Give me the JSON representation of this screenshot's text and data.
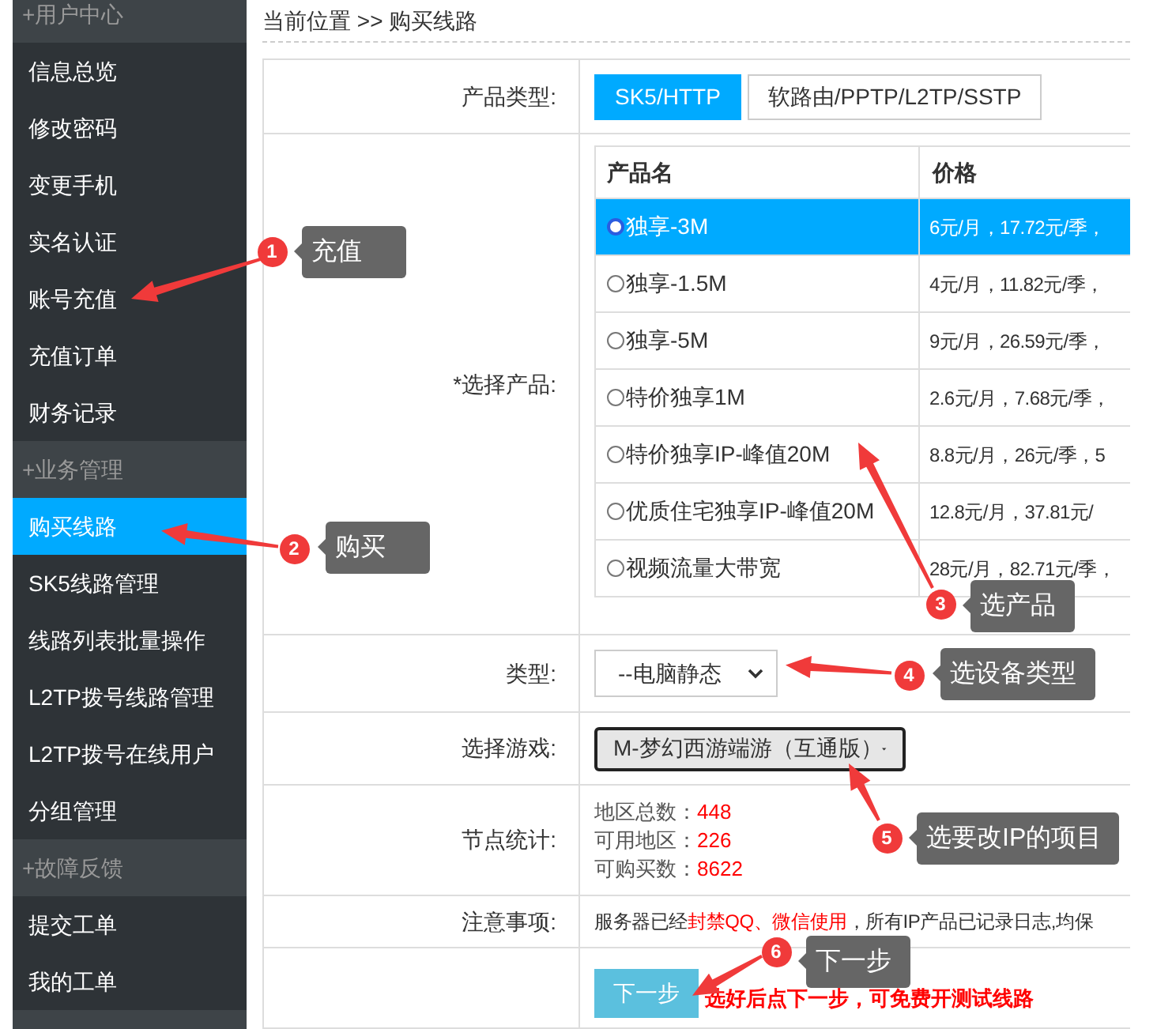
{
  "sidebar": {
    "groups": [
      {
        "title": "+用户中心",
        "items": [
          {
            "label": "信息总览",
            "selected": false
          },
          {
            "label": "修改密码",
            "selected": false
          },
          {
            "label": "变更手机",
            "selected": false
          },
          {
            "label": "实名认证",
            "selected": false
          },
          {
            "label": "账号充值",
            "selected": false
          },
          {
            "label": "充值订单",
            "selected": false
          },
          {
            "label": "财务记录",
            "selected": false
          }
        ]
      },
      {
        "title": "+业务管理",
        "items": [
          {
            "label": "购买线路",
            "selected": true
          },
          {
            "label": "SK5线路管理",
            "selected": false
          },
          {
            "label": "线路列表批量操作",
            "selected": false
          },
          {
            "label": "L2TP拨号线路管理",
            "selected": false
          },
          {
            "label": "L2TP拨号在线用户",
            "selected": false
          },
          {
            "label": "分组管理",
            "selected": false
          }
        ]
      },
      {
        "title": "+故障反馈",
        "items": [
          {
            "label": "提交工单",
            "selected": false
          },
          {
            "label": "我的工单",
            "selected": false
          }
        ]
      }
    ]
  },
  "breadcrumb": "当前位置 >> 购买线路",
  "form": {
    "product_type": {
      "label": "产品类型:",
      "tabs": [
        {
          "label": "SK5/HTTP",
          "selected": true
        },
        {
          "label": "软路由/PPTP/L2TP/SSTP",
          "selected": false
        }
      ]
    },
    "product": {
      "label": "*选择产品:",
      "columns": [
        "产品名",
        "价格"
      ],
      "rows": [
        {
          "name": "独享-3M",
          "price": "6元/月，17.72元/季，",
          "selected": true
        },
        {
          "name": "独享-1.5M",
          "price": "4元/月，11.82元/季，",
          "selected": false
        },
        {
          "name": "独享-5M",
          "price": "9元/月，26.59元/季，",
          "selected": false
        },
        {
          "name": "特价独享1M",
          "price": "2.6元/月，7.68元/季，",
          "selected": false
        },
        {
          "name": "特价独享IP-峰值20M",
          "price": "8.8元/月，26元/季，5",
          "selected": false
        },
        {
          "name": "优质住宅独享IP-峰值20M",
          "price": "12.8元/月，37.81元/",
          "selected": false
        },
        {
          "name": "视频流量大带宽",
          "price": "28元/月，82.71元/季，",
          "selected": false
        }
      ]
    },
    "type": {
      "label": "类型:",
      "value": "--电脑静态"
    },
    "game": {
      "label": "选择游戏:",
      "value": "M-梦幻西游端游（互通版）"
    },
    "stats": {
      "label": "节点统计:",
      "lines": [
        {
          "label": "地区总数：",
          "value": "448"
        },
        {
          "label": "可用地区：",
          "value": "226"
        },
        {
          "label": "可购买数：",
          "value": "8622"
        }
      ]
    },
    "notice": {
      "label": "注意事项:",
      "segments": [
        {
          "text": "服务器已经",
          "highlight": false
        },
        {
          "text": "封禁QQ、微信使用",
          "highlight": true
        },
        {
          "text": "，所有IP产品已记录日志,均保",
          "highlight": false
        }
      ]
    },
    "next_button": "下一步",
    "hint": "选好后点下一步，可免费开测试线路"
  },
  "annotations": [
    {
      "number": "1",
      "label": "充值"
    },
    {
      "number": "2",
      "label": "购买"
    },
    {
      "number": "3",
      "label": "选产品"
    },
    {
      "number": "4",
      "label": "选设备类型"
    },
    {
      "number": "5",
      "label": "选要改IP的项目"
    },
    {
      "number": "6",
      "label": "下一步"
    }
  ]
}
